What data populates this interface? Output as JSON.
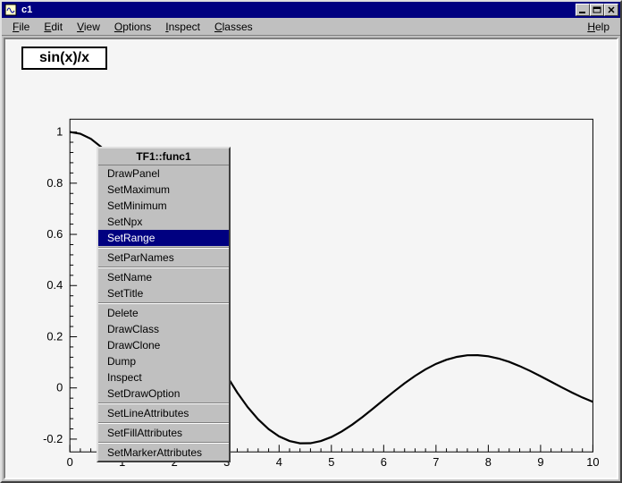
{
  "window": {
    "title": "c1"
  },
  "menubar": {
    "items": [
      "File",
      "Edit",
      "View",
      "Options",
      "Inspect",
      "Classes"
    ],
    "help": "Help"
  },
  "formula": "sin(x)/x",
  "chart_data": {
    "type": "line",
    "title": "sin(x)/x",
    "xlabel": "",
    "ylabel": "",
    "xlim": [
      0,
      10
    ],
    "ylim": [
      -0.25,
      1.05
    ],
    "xticks": [
      0,
      1,
      2,
      3,
      4,
      5,
      6,
      7,
      8,
      9,
      10
    ],
    "yticks": [
      -0.2,
      0,
      0.2,
      0.4,
      0.6,
      0.8,
      1
    ],
    "x": [
      0.0,
      0.2,
      0.4,
      0.6,
      0.8,
      1.0,
      1.2,
      1.4,
      1.6,
      1.8,
      2.0,
      2.2,
      2.4,
      2.6,
      2.8,
      3.0,
      3.2,
      3.4,
      3.6,
      3.8,
      4.0,
      4.2,
      4.4,
      4.6,
      4.8,
      5.0,
      5.2,
      5.4,
      5.6,
      5.8,
      6.0,
      6.2,
      6.4,
      6.6,
      6.8,
      7.0,
      7.2,
      7.4,
      7.6,
      7.8,
      8.0,
      8.2,
      8.4,
      8.6,
      8.8,
      9.0,
      9.2,
      9.4,
      9.6,
      9.8,
      10.0
    ],
    "y": [
      1.0,
      0.9933,
      0.9735,
      0.9411,
      0.8967,
      0.8415,
      0.7767,
      0.7039,
      0.6247,
      0.541,
      0.4546,
      0.3675,
      0.2814,
      0.1983,
      0.1196,
      0.047,
      -0.0182,
      -0.0752,
      -0.1229,
      -0.161,
      -0.1892,
      -0.2075,
      -0.2163,
      -0.216,
      -0.2075,
      -0.1918,
      -0.1699,
      -0.1431,
      -0.1127,
      -0.0801,
      -0.0466,
      -0.0134,
      0.0182,
      0.0472,
      0.0727,
      0.0939,
      0.1102,
      0.1214,
      0.1274,
      0.128,
      0.1237,
      0.1147,
      0.1017,
      0.0854,
      0.0665,
      0.0458,
      0.0242,
      0.0026,
      -0.0182,
      -0.0374,
      -0.0544
    ]
  },
  "context_menu": {
    "title": "TF1::func1",
    "groups": [
      [
        "DrawPanel",
        "SetMaximum",
        "SetMinimum",
        "SetNpx",
        "SetRange"
      ],
      [
        "SetParNames"
      ],
      [
        "SetName",
        "SetTitle"
      ],
      [
        "Delete",
        "DrawClass",
        "DrawClone",
        "Dump",
        "Inspect",
        "SetDrawOption"
      ],
      [
        "SetLineAttributes"
      ],
      [
        "SetFillAttributes"
      ],
      [
        "SetMarkerAttributes"
      ]
    ],
    "selected": "SetRange"
  }
}
